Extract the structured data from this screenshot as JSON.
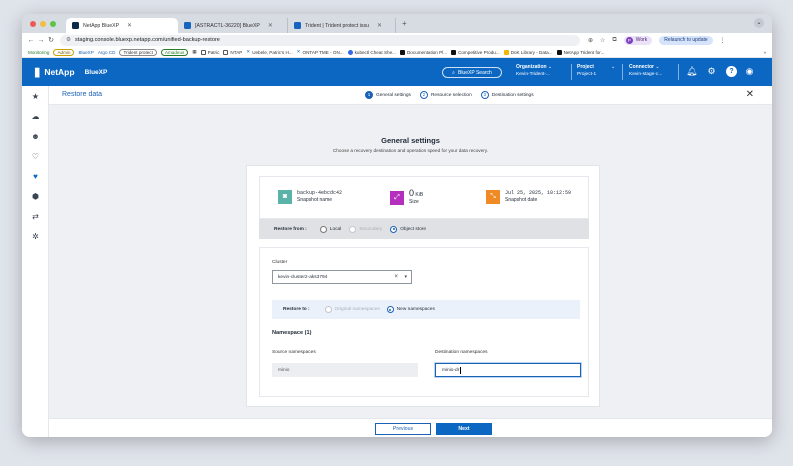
{
  "browser": {
    "tabs": [
      {
        "label": "NetApp BlueXP",
        "color": "#0b2a4a",
        "active": true
      },
      {
        "label": "[ASTRACTL-36220] BlueXP",
        "color": "#1565c0",
        "active": false
      },
      {
        "label": "Trident | Trident protect issu",
        "color": "#1565c0",
        "active": false
      }
    ],
    "new_tab": "+",
    "url": "staging.console.bluexp.netapp.com/unified-backup-restore",
    "profile_label": "Work",
    "profile_initial": "P",
    "relaunch_label": "Relaunch to update",
    "bookmarks": {
      "monitoring": "Monitoring",
      "pills": [
        "Admin",
        "BlueXP",
        "Argo CD",
        "Trident protect",
        "Amadeus"
      ],
      "items": [
        "Patric",
        "NTAP",
        "Uebele, Patric's H...",
        "ONTAP TME - ON...",
        "kubectl Cheat She...",
        "Documentation Pl...",
        "Competitive Produ...",
        "DoK Library - Data...",
        "NetApp Trident for..."
      ],
      "more": "»"
    }
  },
  "header": {
    "brand": "NetApp",
    "product": "BlueXP",
    "search_label": "BlueXP Search",
    "organization": {
      "label": "Organization",
      "value": "Kevin-Trident-..."
    },
    "project": {
      "label": "Project",
      "value": "Project-1"
    },
    "connector": {
      "label": "Connector",
      "value": "Kevin-stage-c..."
    }
  },
  "page": {
    "title": "Restore data",
    "steps": [
      {
        "num": "1",
        "label": "General settings"
      },
      {
        "num": "2",
        "label": "Resource selection"
      },
      {
        "num": "3",
        "label": "Destination settings"
      }
    ],
    "heading": "General settings",
    "subheading": "Choose a recovery destination and operation speed for your data recovery."
  },
  "snapshot": {
    "name_value": "backup-4ebcdc42",
    "name_label": "Snapshot name",
    "size_value": "0",
    "size_unit": "KiB",
    "size_label": "Size",
    "date_value": "Jul 25, 2025, 10:12:59",
    "date_label": "Snapshot date"
  },
  "restore_from": {
    "label": "Restore from :",
    "options": [
      "Local",
      "Secondary",
      "Object store"
    ]
  },
  "cluster": {
    "label": "Cluster",
    "value": "kevin-cluster2-aks3794"
  },
  "restore_to": {
    "label": "Restore to :",
    "options": [
      "Original namespaces",
      "New namespaces"
    ]
  },
  "namespace": {
    "heading": "Namespace (1)",
    "source_label": "Source namespaces",
    "dest_label": "Destination namespaces",
    "source_value": "minio",
    "dest_value": "minio-dr"
  },
  "footer": {
    "previous": "Previous",
    "next": "Next"
  },
  "colors": {
    "brand": "#0c67c3",
    "snapshot_icon": "#5ab3a8",
    "size_icon": "#b52fbf",
    "date_icon": "#f08a24"
  }
}
